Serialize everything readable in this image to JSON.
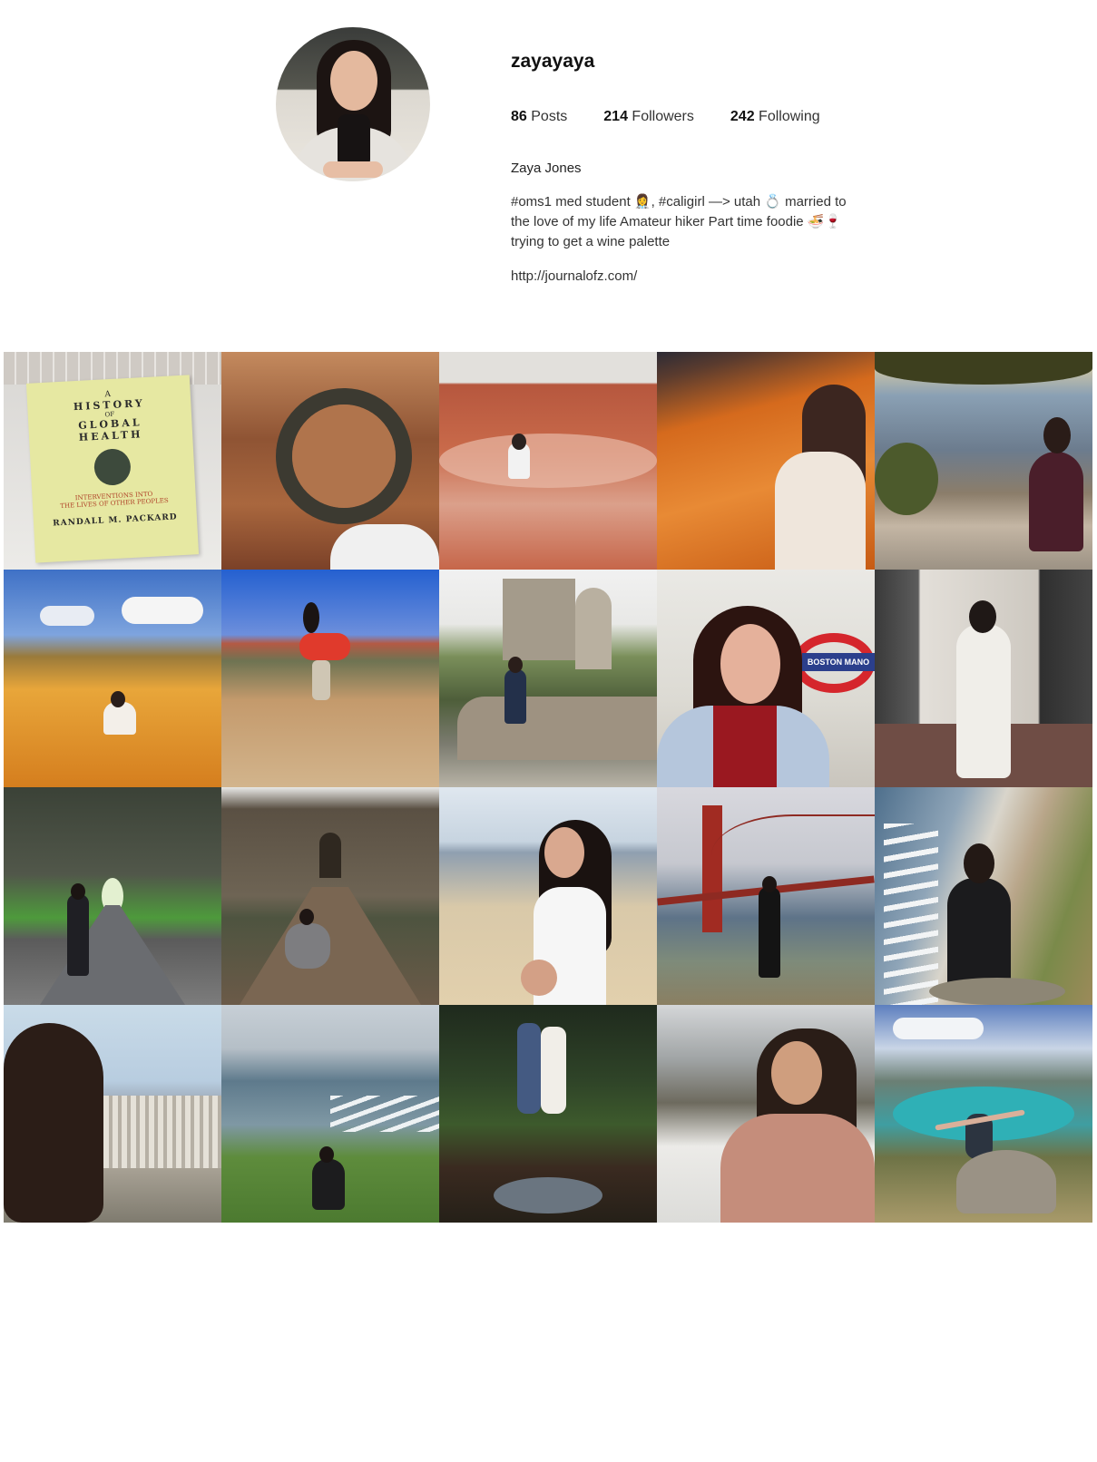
{
  "profile": {
    "username": "zayayaya",
    "stats": [
      {
        "count": "86",
        "label": "Posts"
      },
      {
        "count": "214",
        "label": "Followers"
      },
      {
        "count": "242",
        "label": "Following"
      }
    ],
    "full_name": "Zaya Jones",
    "bio_lines": [
      "#oms1 med student 👩‍⚕️, #caligirl —> utah 💍 married to",
      "the love of my life Amateur hiker Part time foodie 🍜🍷",
      "trying to get a wine palette"
    ],
    "website": "http://journalofz.com/"
  },
  "posts": [
    {
      "subject": "history-of-global-health-book",
      "book": {
        "line1": "A",
        "line2": "HISTORY",
        "line3": "OF",
        "line4": "GLOBAL",
        "line5": "HEALTH",
        "subtitle1": "INTERVENTIONS INTO",
        "subtitle2": "THE LIVES OF OTHER PEOPLES",
        "author": "RANDALL M. PACKARD"
      }
    },
    {
      "subject": "horseshoe-bend-canyon"
    },
    {
      "subject": "red-rock-wave-sitting"
    },
    {
      "subject": "orange-sand-dunes-follow"
    },
    {
      "subject": "grand-canyon-sitting"
    },
    {
      "subject": "desert-dunes-sitting"
    },
    {
      "subject": "jumping-in-desert"
    },
    {
      "subject": "castle-garden-wall"
    },
    {
      "subject": "tube-station-selfie",
      "sign": "BOSTON MANO"
    },
    {
      "subject": "standing-by-wall"
    },
    {
      "subject": "cypress-tree-tunnel"
    },
    {
      "subject": "castle-bridge"
    },
    {
      "subject": "beach-follow-me"
    },
    {
      "subject": "golden-gate-bridge"
    },
    {
      "subject": "coastal-cliff"
    },
    {
      "subject": "city-view-hair"
    },
    {
      "subject": "ocean-grass-sitting"
    },
    {
      "subject": "couple-in-forest"
    },
    {
      "subject": "snowy-mountain-smile"
    },
    {
      "subject": "lake-overlook-arms-out"
    }
  ]
}
